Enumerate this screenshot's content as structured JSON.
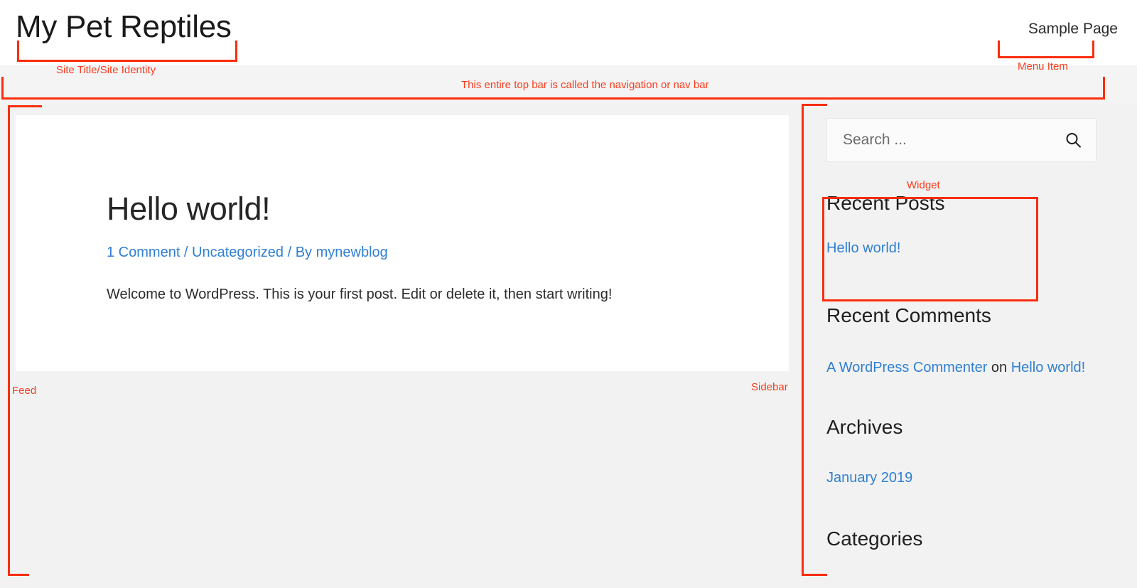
{
  "header": {
    "site_title": "My Pet Reptiles",
    "menu_items": [
      {
        "label": "Sample Page"
      }
    ]
  },
  "main": {
    "post": {
      "title": "Hello world!",
      "meta": {
        "comments_link": "1 Comment",
        "separator_1": " / ",
        "category_link": "Uncategorized",
        "separator_2": " / ",
        "byline_prefix": "By ",
        "author_link": "mynewblog"
      },
      "excerpt": "Welcome to WordPress. This is your first post. Edit or delete it, then start writing!"
    }
  },
  "sidebar": {
    "search": {
      "placeholder": "Search ...",
      "value": "",
      "icon": "search-icon"
    },
    "widgets": [
      {
        "title": "Recent Posts",
        "items": [
          {
            "label": "Hello world!",
            "link": true
          }
        ]
      },
      {
        "title": "Recent Comments",
        "items": [
          {
            "link_1": "A WordPress Commenter",
            "plain": " on ",
            "link_2": "Hello world!"
          }
        ]
      },
      {
        "title": "Archives",
        "items": [
          {
            "label": "January 2019",
            "link": true
          }
        ]
      },
      {
        "title": "Categories",
        "items": []
      }
    ]
  },
  "annotations": {
    "accent_color": "#fa2d0d",
    "labels": {
      "site_title": "Site Title/Site Identity",
      "menu_item": "Menu Item",
      "nav_bar": "This entire top bar is called the navigation or nav bar",
      "widget": "Widget",
      "feed": "Feed",
      "sidebar": "Sidebar"
    }
  }
}
